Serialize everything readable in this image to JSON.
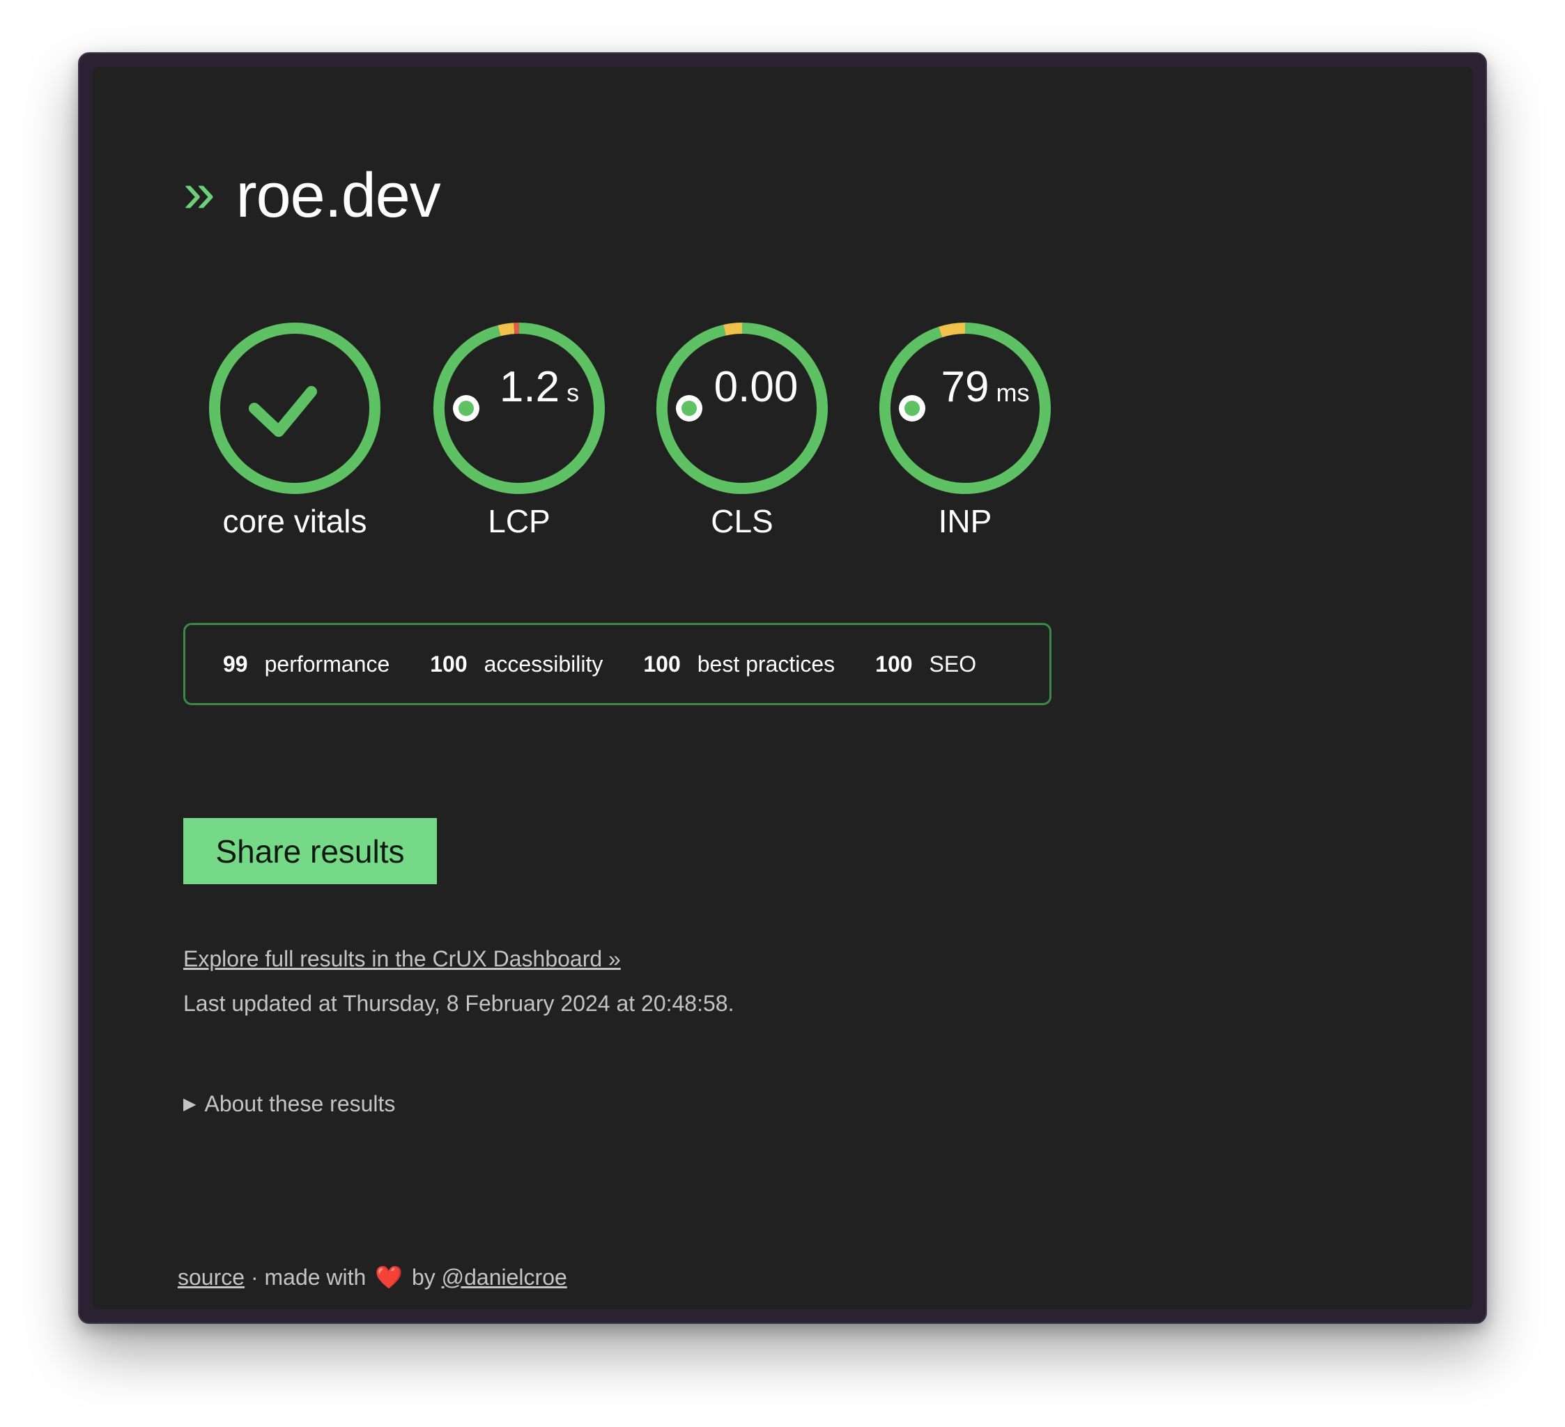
{
  "header": {
    "chevron": "»",
    "site": "roe.dev"
  },
  "colors": {
    "good": "#5ec264",
    "needs_improvement": "#f0c14b",
    "poor": "#e05a45",
    "accent": "#76d988"
  },
  "vitals": [
    {
      "label": "core vitals",
      "icon": "check-icon",
      "value": "",
      "unit": "",
      "distribution": {
        "good": 1.0,
        "ni": 0.0,
        "poor": 0.0
      }
    },
    {
      "label": "LCP",
      "icon": "",
      "value": "1.2",
      "unit": "s",
      "distribution": {
        "good": 0.96,
        "ni": 0.03,
        "poor": 0.01
      }
    },
    {
      "label": "CLS",
      "icon": "",
      "value": "0.00",
      "unit": "",
      "distribution": {
        "good": 0.965,
        "ni": 0.035,
        "poor": 0.0
      }
    },
    {
      "label": "INP",
      "icon": "",
      "value": "79",
      "unit": "ms",
      "distribution": {
        "good": 0.95,
        "ni": 0.05,
        "poor": 0.0
      }
    }
  ],
  "scores": [
    {
      "value": "99",
      "label": "performance"
    },
    {
      "value": "100",
      "label": "accessibility"
    },
    {
      "value": "100",
      "label": "best practices"
    },
    {
      "value": "100",
      "label": "SEO"
    }
  ],
  "share_button": "Share results",
  "crux_link": "Explore full results in the CrUX Dashboard »",
  "last_updated": "Last updated at Thursday, 8 February 2024 at 20:48:58.",
  "about": {
    "marker": "▶",
    "label": "About these results"
  },
  "footer": {
    "source": "source",
    "separator": " · made with ",
    "heart": "❤️",
    "by": " by ",
    "author": "@danielcroe"
  }
}
